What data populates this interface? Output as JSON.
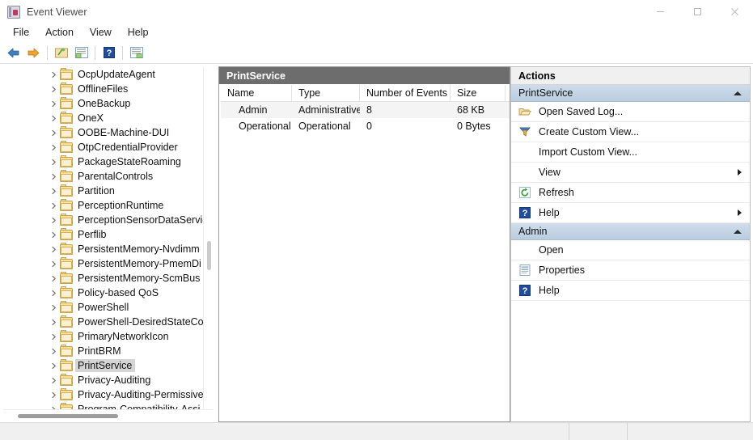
{
  "window": {
    "title": "Event Viewer",
    "icon": "event-viewer-icon",
    "controls": {
      "minimize": "minimize-icon",
      "maximize": "maximize-icon",
      "close": "close-icon"
    }
  },
  "menubar": {
    "items": [
      {
        "label": "File"
      },
      {
        "label": "Action"
      },
      {
        "label": "View"
      },
      {
        "label": "Help"
      }
    ]
  },
  "toolbar": {
    "buttons": [
      {
        "name": "back-button",
        "icon": "back-arrow-icon"
      },
      {
        "name": "forward-button",
        "icon": "forward-arrow-icon"
      },
      {
        "name": "up-one-level-button",
        "icon": "folder-up-icon"
      },
      {
        "name": "show-hide-console-tree-button",
        "icon": "console-tree-icon"
      },
      {
        "name": "help-button",
        "icon": "help-question-icon"
      },
      {
        "name": "show-hide-action-pane-button",
        "icon": "action-pane-icon"
      }
    ]
  },
  "tree": {
    "items": [
      {
        "label": "OcpUpdateAgent",
        "selected": false
      },
      {
        "label": "OfflineFiles",
        "selected": false
      },
      {
        "label": "OneBackup",
        "selected": false
      },
      {
        "label": "OneX",
        "selected": false
      },
      {
        "label": "OOBE-Machine-DUI",
        "selected": false
      },
      {
        "label": "OtpCredentialProvider",
        "selected": false
      },
      {
        "label": "PackageStateRoaming",
        "selected": false
      },
      {
        "label": "ParentalControls",
        "selected": false
      },
      {
        "label": "Partition",
        "selected": false
      },
      {
        "label": "PerceptionRuntime",
        "selected": false
      },
      {
        "label": "PerceptionSensorDataServic",
        "selected": false
      },
      {
        "label": "Perflib",
        "selected": false
      },
      {
        "label": "PersistentMemory-Nvdimm",
        "selected": false
      },
      {
        "label": "PersistentMemory-PmemDi",
        "selected": false
      },
      {
        "label": "PersistentMemory-ScmBus",
        "selected": false
      },
      {
        "label": "Policy-based QoS",
        "selected": false
      },
      {
        "label": "PowerShell",
        "selected": false
      },
      {
        "label": "PowerShell-DesiredStateCon",
        "selected": false
      },
      {
        "label": "PrimaryNetworkIcon",
        "selected": false
      },
      {
        "label": "PrintBRM",
        "selected": false
      },
      {
        "label": "PrintService",
        "selected": true
      },
      {
        "label": "Privacy-Auditing",
        "selected": false
      },
      {
        "label": "Privacy-Auditing-Permissive",
        "selected": false
      },
      {
        "label": "Program-Compatibility-Assi",
        "selected": false
      }
    ]
  },
  "center": {
    "caption": "PrintService",
    "columns": [
      {
        "label": "Name"
      },
      {
        "label": "Type"
      },
      {
        "label": "Number of Events"
      },
      {
        "label": "Size"
      }
    ],
    "rows": [
      {
        "name": "Admin",
        "type": "Administrative",
        "events": "8",
        "size": "68 KB"
      },
      {
        "name": "Operational",
        "type": "Operational",
        "events": "0",
        "size": "0 Bytes"
      }
    ]
  },
  "actions": {
    "caption": "Actions",
    "groups": [
      {
        "title": "PrintService",
        "items": [
          {
            "label": "Open Saved Log...",
            "icon": "open-folder-icon",
            "submenu": false
          },
          {
            "label": "Create Custom View...",
            "icon": "funnel-filter-icon",
            "submenu": false
          },
          {
            "label": "Import Custom View...",
            "icon": "none",
            "submenu": false
          },
          {
            "label": "View",
            "icon": "none",
            "submenu": true
          },
          {
            "label": "Refresh",
            "icon": "refresh-icon",
            "submenu": false
          },
          {
            "label": "Help",
            "icon": "help-question-icon",
            "submenu": true
          }
        ]
      },
      {
        "title": "Admin",
        "items": [
          {
            "label": "Open",
            "icon": "none",
            "submenu": false
          },
          {
            "label": "Properties",
            "icon": "properties-icon",
            "submenu": false
          },
          {
            "label": "Help",
            "icon": "help-question-icon",
            "submenu": false
          }
        ]
      }
    ]
  },
  "statusbar": {
    "segments": [
      "",
      "",
      ""
    ]
  },
  "colors": {
    "pane_caption_bg": "#6d6d6d",
    "group_header_bg": "#b9cde0",
    "selection_bg": "#d5d5d5",
    "alt_row_bg": "#f4f4f4",
    "folder_fill": "#f5dea4"
  }
}
